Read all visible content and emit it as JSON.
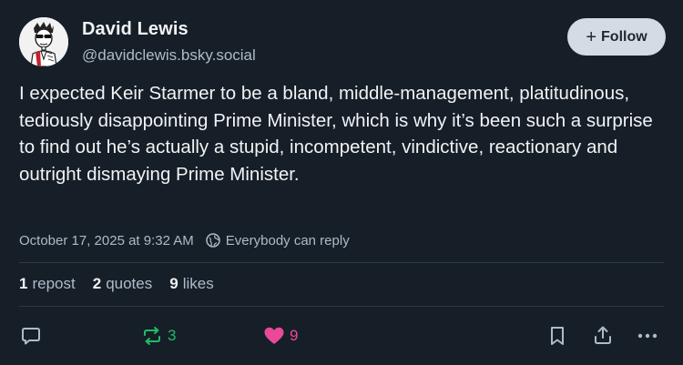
{
  "author": {
    "name": "David Lewis",
    "handle": "@davidclewis.bsky.social"
  },
  "follow_button": {
    "icon": "plus-icon",
    "label": "Follow"
  },
  "post": {
    "text": "I expected Keir Starmer to be a bland, middle-management, platitudinous, tediously disappointing Prime Minister, which is why it’s been such a surprise to find out he’s actually a stupid, incompetent, vindictive, reactionary and outright dismaying Prime Minister.",
    "timestamp": "October 17, 2025 at 9:32 AM",
    "reply_setting": "Everybody can reply"
  },
  "stats": {
    "reposts": {
      "count": "1",
      "label": "repost"
    },
    "quotes": {
      "count": "2",
      "label": "quotes"
    },
    "likes": {
      "count": "9",
      "label": "likes"
    }
  },
  "actions": {
    "reply": {
      "icon": "reply-icon"
    },
    "repost": {
      "icon": "repost-icon",
      "count": "3"
    },
    "like": {
      "icon": "heart-icon",
      "count": "9"
    },
    "bookmark": {
      "icon": "bookmark-icon"
    },
    "share": {
      "icon": "share-icon"
    },
    "more": {
      "icon": "more-icon"
    }
  },
  "colors": {
    "background": "#161e27",
    "text": "#f1f3f5",
    "muted": "#aebbc9",
    "repost_active": "#20bc68",
    "like_active": "#ec4899",
    "follow_bg": "#d4dbe2"
  }
}
